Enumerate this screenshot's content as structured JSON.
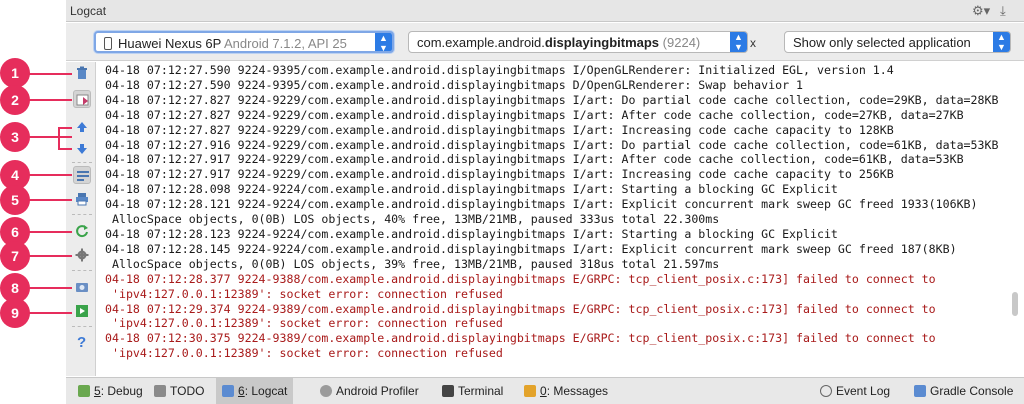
{
  "window": {
    "title": "Logcat"
  },
  "toolbar": {
    "device": {
      "name": "Huawei Nexus 6P",
      "detail": "Android 7.1.2, API 25"
    },
    "process": {
      "prefix": "com.example.android.",
      "name_bold": "displayingbitmaps",
      "pid": "(9224)"
    },
    "regex_fragment": "x",
    "filter": {
      "selected": "Show only selected application"
    }
  },
  "left_tools": [
    {
      "icon": "trash-icon"
    },
    {
      "icon": "scroll-to-end-icon"
    },
    {
      "icon": "up-arrow-icon"
    },
    {
      "icon": "down-arrow-icon"
    },
    {
      "icon": "soft-wraps-icon"
    },
    {
      "icon": "print-icon"
    },
    {
      "icon": "restart-icon"
    },
    {
      "icon": "settings-icon"
    },
    {
      "icon": "screen-capture-icon"
    },
    {
      "icon": "screen-record-icon"
    },
    {
      "icon": "help-icon"
    }
  ],
  "callouts": [
    "1",
    "2",
    "3",
    "4",
    "5",
    "6",
    "7",
    "8",
    "9"
  ],
  "log_lines": [
    {
      "text": "04-18 07:12:27.590 9224-9395/com.example.android.displayingbitmaps I/OpenGLRenderer: Initialized EGL, version 1.4",
      "level": "info"
    },
    {
      "text": "04-18 07:12:27.590 9224-9395/com.example.android.displayingbitmaps D/OpenGLRenderer: Swap behavior 1",
      "level": "info"
    },
    {
      "text": "04-18 07:12:27.827 9224-9229/com.example.android.displayingbitmaps I/art: Do partial code cache collection, code=29KB, data=28KB",
      "level": "info"
    },
    {
      "text": "04-18 07:12:27.827 9224-9229/com.example.android.displayingbitmaps I/art: After code cache collection, code=27KB, data=27KB",
      "level": "info"
    },
    {
      "text": "04-18 07:12:27.827 9224-9229/com.example.android.displayingbitmaps I/art: Increasing code cache capacity to 128KB",
      "level": "info"
    },
    {
      "text": "04-18 07:12:27.916 9224-9229/com.example.android.displayingbitmaps I/art: Do partial code cache collection, code=61KB, data=53KB",
      "level": "info"
    },
    {
      "text": "04-18 07:12:27.917 9224-9229/com.example.android.displayingbitmaps I/art: After code cache collection, code=61KB, data=53KB",
      "level": "info"
    },
    {
      "text": "04-18 07:12:27.917 9224-9229/com.example.android.displayingbitmaps I/art: Increasing code cache capacity to 256KB",
      "level": "info"
    },
    {
      "text": "04-18 07:12:28.098 9224-9224/com.example.android.displayingbitmaps I/art: Starting a blocking GC Explicit",
      "level": "info"
    },
    {
      "text": "04-18 07:12:28.121 9224-9224/com.example.android.displayingbitmaps I/art: Explicit concurrent mark sweep GC freed 1933(106KB)",
      "level": "info"
    },
    {
      "text": " AllocSpace objects, 0(0B) LOS objects, 40% free, 13MB/21MB, paused 333us total 22.300ms",
      "level": "info"
    },
    {
      "text": "04-18 07:12:28.123 9224-9224/com.example.android.displayingbitmaps I/art: Starting a blocking GC Explicit",
      "level": "info"
    },
    {
      "text": "04-18 07:12:28.145 9224-9224/com.example.android.displayingbitmaps I/art: Explicit concurrent mark sweep GC freed 187(8KB)",
      "level": "info"
    },
    {
      "text": " AllocSpace objects, 0(0B) LOS objects, 39% free, 13MB/21MB, paused 318us total 21.597ms",
      "level": "info"
    },
    {
      "text": "04-18 07:12:28.377 9224-9388/com.example.android.displayingbitmaps E/GRPC: tcp_client_posix.c:173] failed to connect to",
      "level": "error"
    },
    {
      "text": " 'ipv4:127.0.0.1:12389': socket error: connection refused",
      "level": "error"
    },
    {
      "text": "04-18 07:12:29.374 9224-9389/com.example.android.displayingbitmaps E/GRPC: tcp_client_posix.c:173] failed to connect to",
      "level": "error"
    },
    {
      "text": " 'ipv4:127.0.0.1:12389': socket error: connection refused",
      "level": "error"
    },
    {
      "text": "04-18 07:12:30.375 9224-9389/com.example.android.displayingbitmaps E/GRPC: tcp_client_posix.c:173] failed to connect to",
      "level": "error"
    },
    {
      "text": " 'ipv4:127.0.0.1:12389': socket error: connection refused",
      "level": "error"
    }
  ],
  "bottom_tabs": [
    {
      "key": "5",
      "rest": ": Debug",
      "icon": "debug-icon"
    },
    {
      "key": "",
      "rest": "TODO",
      "icon": "todo-icon"
    },
    {
      "key": "6",
      "rest": ": Logcat",
      "icon": "logcat-icon",
      "active": true
    },
    {
      "key": "",
      "rest": "Android Profiler",
      "icon": "profiler-icon"
    },
    {
      "key": "",
      "rest": "Terminal",
      "icon": "terminal-icon"
    },
    {
      "key": "0",
      "rest": ": Messages",
      "icon": "messages-icon"
    }
  ],
  "bottom_right_tabs": [
    {
      "label": "Event Log",
      "icon": "event-log-icon"
    },
    {
      "label": "Gradle Console",
      "icon": "gradle-console-icon"
    }
  ],
  "colors": {
    "accent": "#2c7be5",
    "callout": "#e62d5c",
    "error_text": "#a81a1a"
  }
}
